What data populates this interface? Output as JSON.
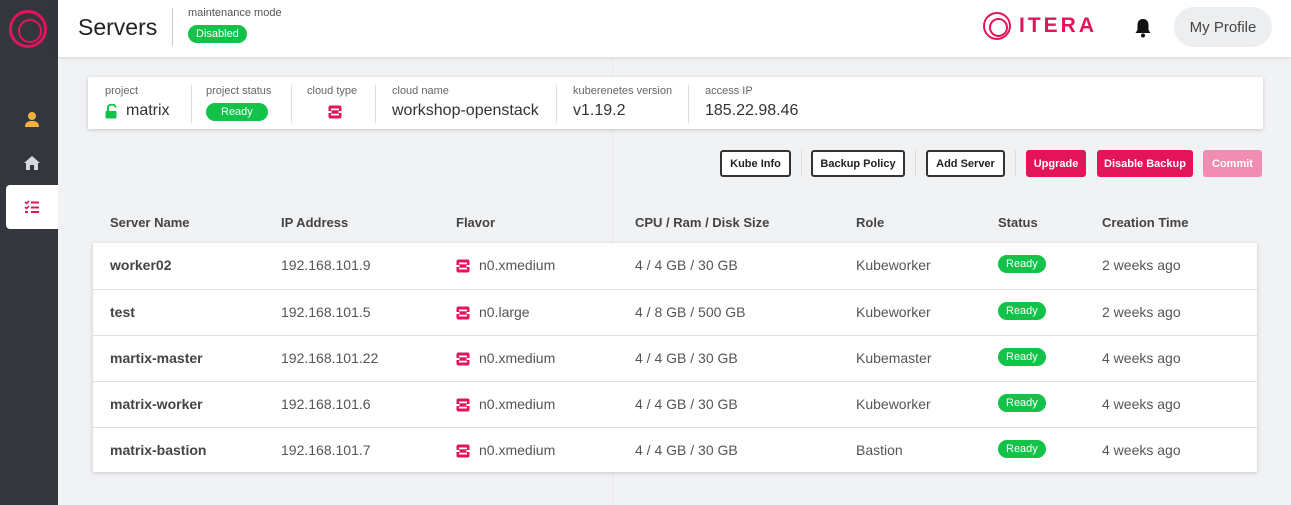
{
  "sidebar": {
    "logo": "itera-ring-logo",
    "items": [
      {
        "icon": "user-icon",
        "active": false
      },
      {
        "icon": "home-icon",
        "active": false
      },
      {
        "icon": "list-check-icon",
        "active": true
      }
    ]
  },
  "header": {
    "title": "Servers",
    "maintenance_label": "maintenance mode",
    "maintenance_status": "Disabled",
    "brand": "ITERA",
    "profile_label": "My Profile"
  },
  "project_info": {
    "project_label": "project",
    "project_value": "matrix",
    "status_label": "project status",
    "status_value": "Ready",
    "cloud_type_label": "cloud type",
    "cloud_type_icon": "openstack-icon",
    "cloud_name_label": "cloud name",
    "cloud_name_value": "workshop-openstack",
    "k8s_label": "kuberenetes version",
    "k8s_value": "v1.19.2",
    "ip_label": "access IP",
    "ip_value": "185.22.98.46"
  },
  "actions": {
    "kube_info": "Kube Info",
    "backup_policy": "Backup Policy",
    "add_server": "Add Server",
    "upgrade": "Upgrade",
    "disable_backup": "Disable Backup",
    "commit": "Commit"
  },
  "table": {
    "columns": [
      "Server Name",
      "IP Address",
      "Flavor",
      "CPU / Ram / Disk Size",
      "Role",
      "Status",
      "Creation Time"
    ],
    "rows": [
      {
        "name": "worker02",
        "ip": "192.168.101.9",
        "flavor": "n0.xmedium",
        "size": "4 / 4 GB / 30 GB",
        "role": "Kubeworker",
        "status": "Ready",
        "created": "2 weeks ago"
      },
      {
        "name": "test",
        "ip": "192.168.101.5",
        "flavor": "n0.large",
        "size": "4 / 8 GB / 500 GB",
        "role": "Kubeworker",
        "status": "Ready",
        "created": "2 weeks ago"
      },
      {
        "name": "martix-master",
        "ip": "192.168.101.22",
        "flavor": "n0.xmedium",
        "size": "4 / 4 GB / 30 GB",
        "role": "Kubemaster",
        "status": "Ready",
        "created": "4 weeks ago"
      },
      {
        "name": "matrix-worker",
        "ip": "192.168.101.6",
        "flavor": "n0.xmedium",
        "size": "4 / 4 GB / 30 GB",
        "role": "Kubeworker",
        "status": "Ready",
        "created": "4 weeks ago"
      },
      {
        "name": "matrix-bastion",
        "ip": "192.168.101.7",
        "flavor": "n0.xmedium",
        "size": "4 / 4 GB / 30 GB",
        "role": "Bastion",
        "status": "Ready",
        "created": "4 weeks ago"
      }
    ]
  },
  "colors": {
    "brand": "#e3155a",
    "ready": "#12c249",
    "sidebar": "#33373d"
  }
}
